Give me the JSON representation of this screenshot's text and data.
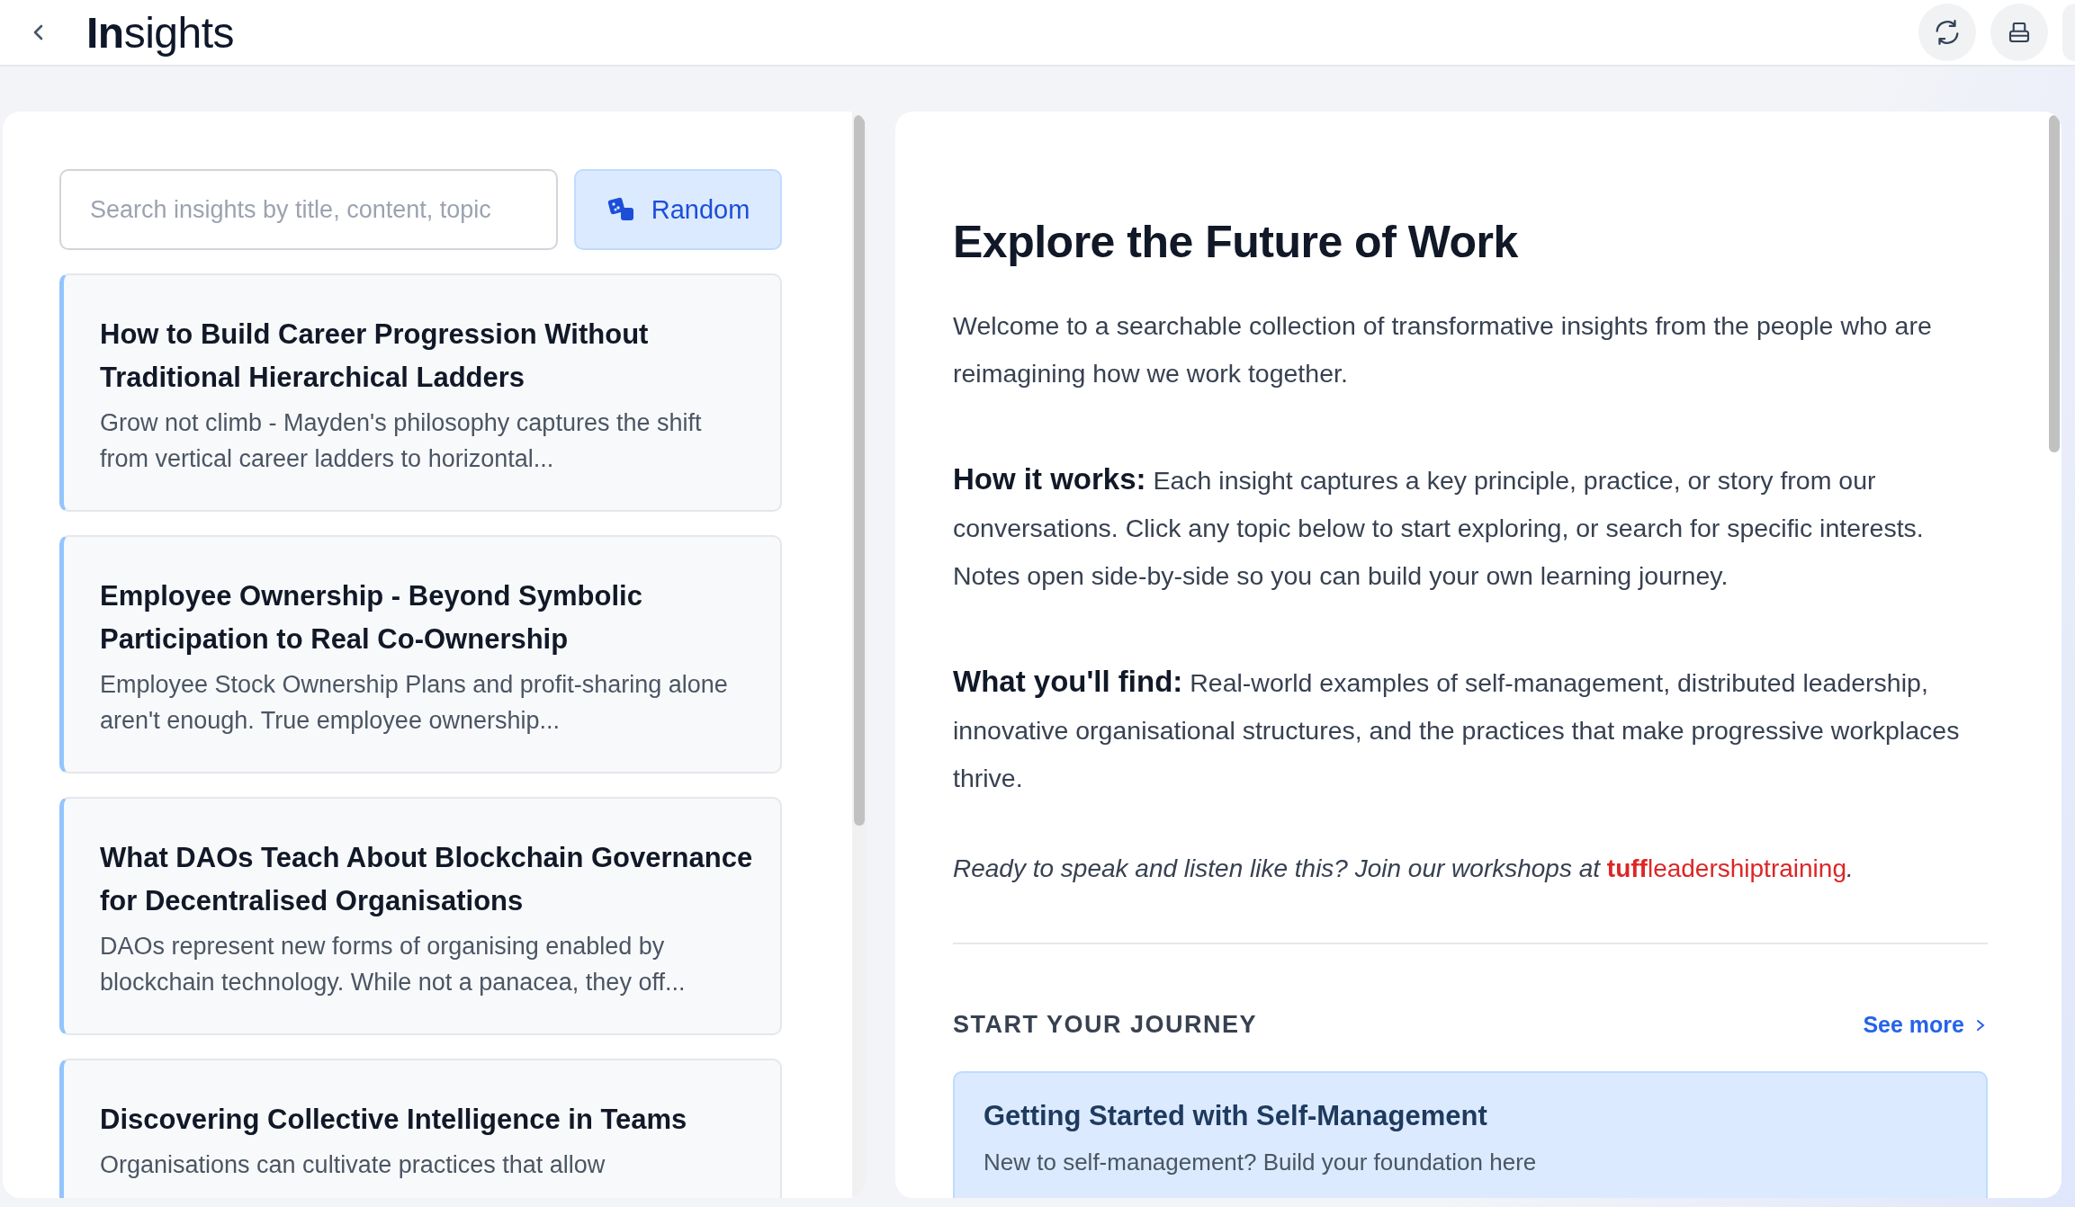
{
  "header": {
    "title": "**In**sights"
  },
  "search": {
    "placeholder": "Search insights by title, content, topic"
  },
  "random_button": {
    "label": "Random"
  },
  "insights": [
    {
      "title": "How to Build Career Progression Without Traditional Hierarchical Ladders",
      "summary": "Grow not climb - Mayden's philosophy captures the shift from vertical career ladders to horizontal..."
    },
    {
      "title": "Employee Ownership - Beyond Symbolic Participation to Real Co-Ownership",
      "summary": "Employee Stock Ownership Plans and profit-sharing alone aren't enough. True employee ownership..."
    },
    {
      "title": "What DAOs Teach About Blockchain Governance for Decentralised Organisations",
      "summary": "DAOs represent new forms of organising enabled by blockchain technology. While not a panacea, they off..."
    },
    {
      "title": "Discovering Collective Intelligence in Teams",
      "summary": "Organisations can cultivate practices that allow"
    }
  ],
  "intro": {
    "heading": "Explore the Future of Work",
    "welcome": "Welcome to a searchable collection of transformative insights from the people who are reimagining how we work together.",
    "paragraphs": [
      {
        "label": "How it works:",
        "text": "Each insight captures a key principle, practice, or story from our conversations. Click any topic below to start exploring, or search for specific interests. Notes open side-by-side so you can build your own learning journey."
      },
      {
        "label": "What you'll find:",
        "text": "Real-world examples of self-management, distributed leadership, innovative organisational structures, and the practices that make progressive workplaces thrive."
      }
    ],
    "cta": {
      "text": "Ready to speak and listen like this? Join our workshops at",
      "link": "**tuff**leadershiptraining",
      "end": "."
    }
  },
  "journey": {
    "title": "START YOUR JOURNEY",
    "see_more": "See more",
    "cards": [
      {
        "title": "Getting Started with Self-Management",
        "description": "New to self-management? Build your foundation here"
      }
    ]
  }
}
